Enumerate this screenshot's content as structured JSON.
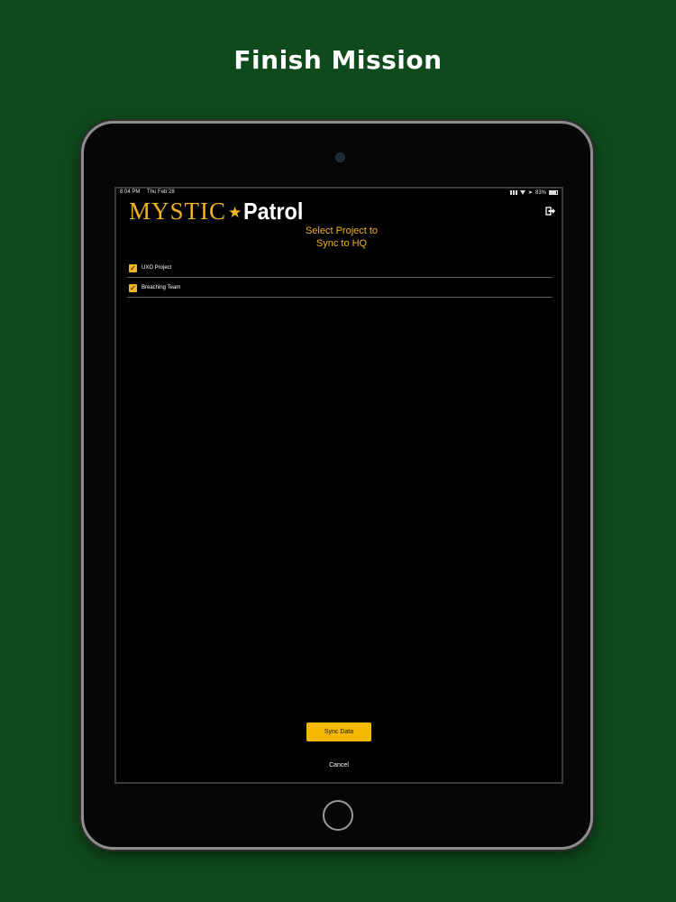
{
  "headline": "Finish Mission",
  "status_bar": {
    "time": "8:04 PM",
    "date": "Thu Feb 28",
    "battery": "83%",
    "battery_level": 0.83
  },
  "app": {
    "logo_word1": "MYSTIC",
    "logo_word2": "Patrol",
    "logo_star": "★",
    "brand_color": "#f0b321",
    "logout_icon": "logout-icon"
  },
  "prompt": {
    "line1": "Select Project to",
    "line2": "Sync to HQ"
  },
  "projects": [
    {
      "label": "UXO Project",
      "checked": true
    },
    {
      "label": "Breaching Team",
      "checked": true
    }
  ],
  "actions": {
    "sync_label": "Sync Data",
    "cancel_label": "Cancel"
  }
}
